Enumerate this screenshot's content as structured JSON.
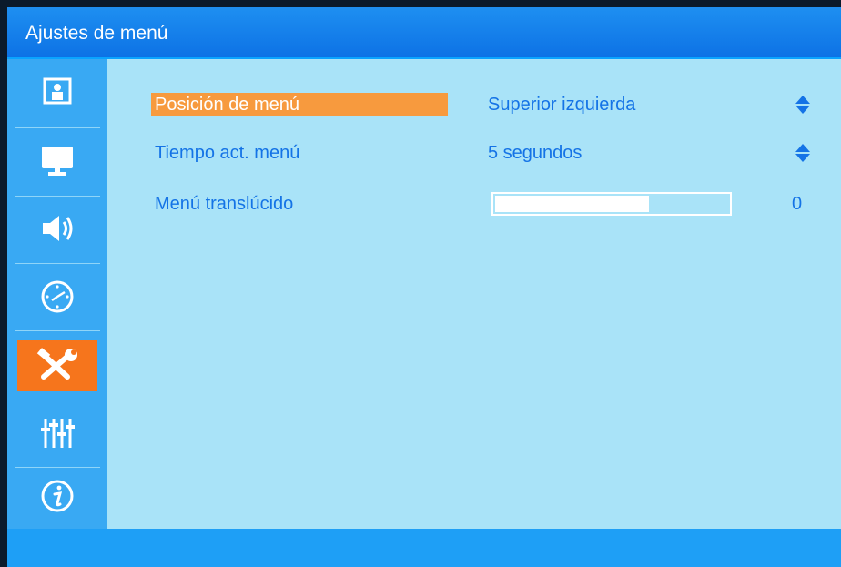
{
  "title": "Ajustes de menú",
  "sidebar": {
    "items": [
      {
        "name": "picture-icon",
        "active": false
      },
      {
        "name": "display-icon",
        "active": false
      },
      {
        "name": "audio-icon",
        "active": false
      },
      {
        "name": "timer-icon",
        "active": false
      },
      {
        "name": "setup-tools-icon",
        "active": true
      },
      {
        "name": "advanced-sliders-icon",
        "active": false
      },
      {
        "name": "info-icon",
        "active": false
      }
    ]
  },
  "settings": {
    "menu_position": {
      "label": "Posición de menú",
      "value": "Superior izquierda",
      "selected": true
    },
    "menu_timeout": {
      "label": "Tiempo act. menú",
      "value": "5 segundos"
    },
    "menu_transparency": {
      "label": "Menú translúcido",
      "value": "0",
      "level_fraction": 0.66
    }
  },
  "colors": {
    "title_bar": "#0d72e5",
    "sidebar": "#39a9f3",
    "content_bg": "#a9e3f8",
    "active_tile": "#f6751c",
    "selection": "#f79a3e",
    "text": "#1473e6"
  }
}
